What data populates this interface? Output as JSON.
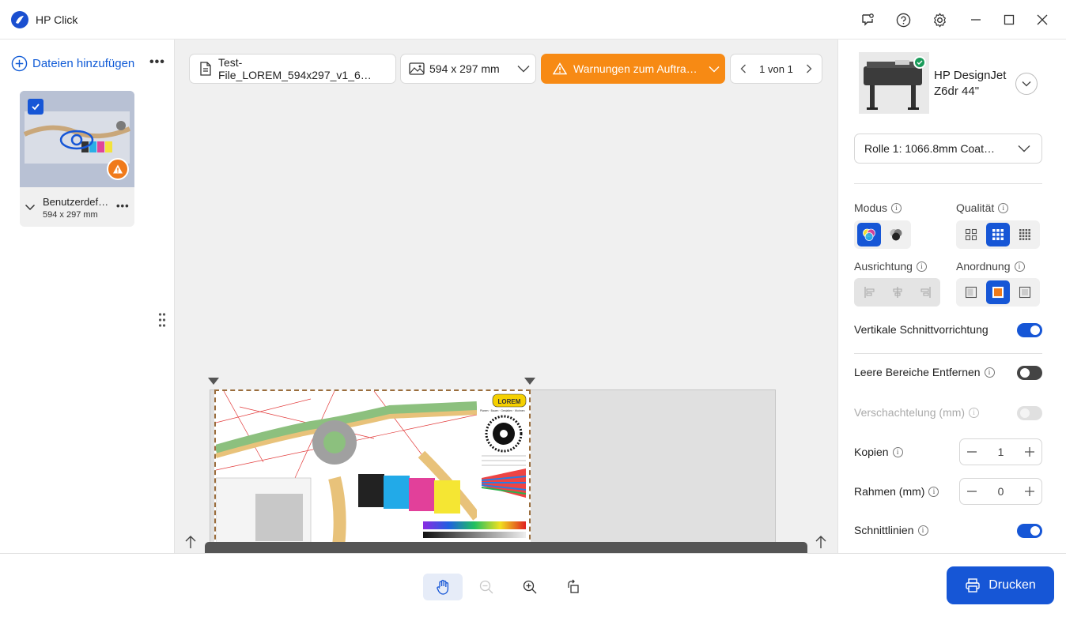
{
  "app": {
    "title": "HP Click"
  },
  "files": {
    "add_label": "Dateien hinzufügen",
    "more": "•••",
    "items": [
      {
        "name": "Benutzerdef…",
        "size": "594 x 297 mm",
        "more": "•••"
      }
    ]
  },
  "toolbar": {
    "file_name": "Test-File_LOREM_594x297_v1_6…",
    "page_size": "594 x 297 mm",
    "warning": "Warnungen zum Auftra…",
    "page_counter": "1 von 1"
  },
  "preview": {
    "logo_text": "LOREM",
    "header_text": "Planen · Bauen · Gestalten · Wohnen"
  },
  "printer": {
    "name": "HP DesignJet Z6dr 44\"",
    "roll": "Rolle 1: 1066.8mm Coat…"
  },
  "settings": {
    "modus": "Modus",
    "qualitaet": "Qualität",
    "ausrichtung": "Ausrichtung",
    "anordnung": "Anordnung",
    "vertikale": {
      "label": "Vertikale Schnittvorrichtung",
      "on": true
    },
    "leere": {
      "label": "Leere Bereiche Entfernen",
      "on": false
    },
    "verschachtelung": {
      "label": "Verschachtelung (mm)",
      "on": false
    },
    "kopien": {
      "label": "Kopien",
      "value": "1"
    },
    "rahmen": {
      "label": "Rahmen (mm)",
      "value": "0"
    },
    "schnittlinien": {
      "label": "Schnittlinien",
      "on": true
    },
    "info_glyph": "i"
  },
  "actions": {
    "print_label": "Drucken"
  },
  "colors": {
    "accent": "#1656d6",
    "warning": "#f78a14",
    "toggle_off": "#444444"
  }
}
